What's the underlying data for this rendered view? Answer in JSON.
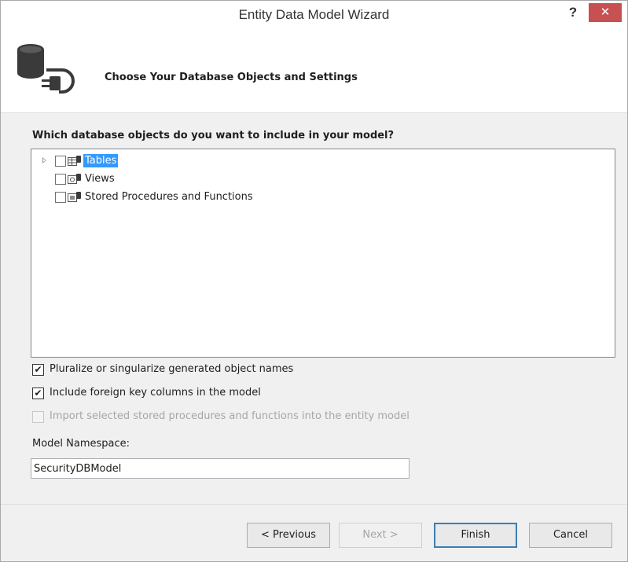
{
  "window": {
    "title": "Entity Data Model Wizard",
    "help_label": "?",
    "close_label": "✕"
  },
  "header": {
    "title": "Choose Your Database Objects and Settings",
    "icon": "database-connect-icon"
  },
  "objects": {
    "question": "Which database objects do you want to include in your model?",
    "items": [
      {
        "label": "Tables",
        "checked": false,
        "expandable": true,
        "selected": true,
        "icon": "table-icon"
      },
      {
        "label": "Views",
        "checked": false,
        "expandable": false,
        "selected": false,
        "icon": "view-icon"
      },
      {
        "label": "Stored Procedures and Functions",
        "checked": false,
        "expandable": false,
        "selected": false,
        "icon": "stored-procedure-icon"
      }
    ]
  },
  "options": {
    "pluralize": {
      "label": "Pluralize or singularize generated object names",
      "checked": true,
      "enabled": true
    },
    "foreign_keys": {
      "label": "Include foreign key columns in the model",
      "checked": true,
      "enabled": true
    },
    "import_procs": {
      "label": "Import selected stored procedures and functions into the entity model",
      "checked": false,
      "enabled": false
    }
  },
  "namespace": {
    "label": "Model Namespace:",
    "value": "SecurityDBModel"
  },
  "buttons": {
    "previous": "< Previous",
    "next": "Next >",
    "finish": "Finish",
    "cancel": "Cancel"
  },
  "colors": {
    "selection": "#3399ff",
    "close_button": "#c75050",
    "default_button_border": "#3c7fb1"
  }
}
